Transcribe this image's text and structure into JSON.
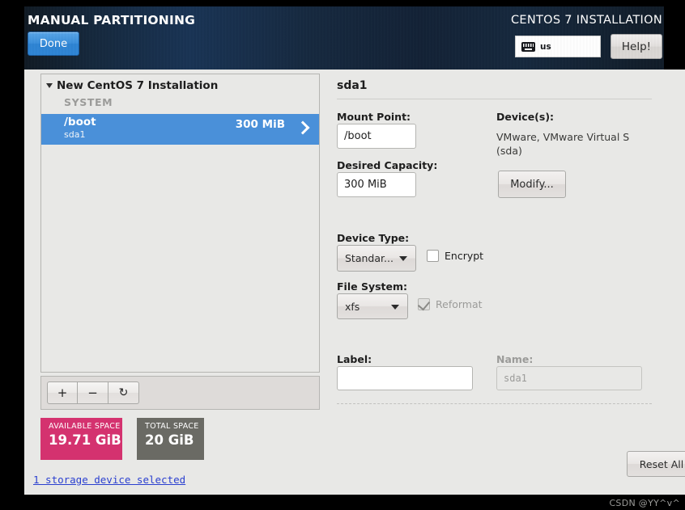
{
  "header": {
    "title": "MANUAL PARTITIONING",
    "done_label": "Done",
    "install_title": "CENTOS 7 INSTALLATION",
    "keyboard_icon": "keyboard-icon",
    "keyboard_layout": "us",
    "help_label": "Help!"
  },
  "left_panel": {
    "tree_root": "New CentOS 7 Installation",
    "group_label": "SYSTEM",
    "partitions": [
      {
        "mount": "/boot",
        "device": "sda1",
        "size": "300 MiB",
        "selected": true
      }
    ],
    "toolbar": {
      "add_label": "+",
      "remove_label": "−",
      "refresh_label": "↻"
    },
    "space": {
      "available_caption": "AVAILABLE SPACE",
      "available_value": "19.71 GiB",
      "available_color": "#d4326f",
      "total_caption": "TOTAL SPACE",
      "total_value": "20 GiB",
      "total_color": "#6a6a64"
    },
    "storage_link": "1 storage device selected"
  },
  "right_panel": {
    "title": "sda1",
    "mount_point_label": "Mount Point:",
    "mount_point_value": "/boot",
    "capacity_label": "Desired Capacity:",
    "capacity_value": "300 MiB",
    "devices_label": "Device(s):",
    "devices_value": "VMware, VMware Virtual S (sda)",
    "modify_label": "Modify...",
    "device_type_label": "Device Type:",
    "device_type_value": "Standar...",
    "encrypt_label": "Encrypt",
    "encrypt_checked": false,
    "file_system_label": "File System:",
    "file_system_value": "xfs",
    "reformat_label": "Reformat",
    "reformat_checked": true,
    "label_label": "Label:",
    "label_value": "",
    "name_label": "Name:",
    "name_placeholder": "sda1",
    "reset_label": "Reset All"
  },
  "watermark": "CSDN @YY^v^",
  "colors": {
    "accent_blue": "#4a90d9",
    "header_dark": "#16293f",
    "content_bg": "#e8e8e6"
  }
}
